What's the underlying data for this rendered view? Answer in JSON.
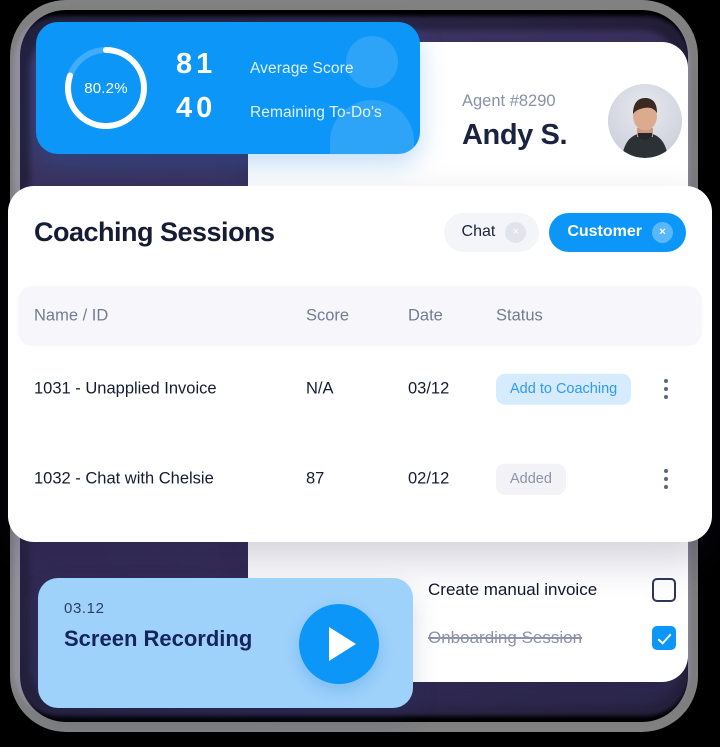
{
  "stats": {
    "donut_value": "80.2%",
    "donut_percent": 80.2,
    "rows": [
      {
        "number": "81",
        "label": "Average Score"
      },
      {
        "number": "40",
        "label": "Remaining To-Do's"
      }
    ]
  },
  "agent": {
    "id_label": "Agent #8290",
    "name": "Andy S."
  },
  "coaching": {
    "title": "Coaching Sessions",
    "chips": [
      {
        "label": "Chat",
        "style": "ghost",
        "close": "×"
      },
      {
        "label": "Customer",
        "style": "solid",
        "close": "×"
      }
    ],
    "columns": [
      "Name / ID",
      "Score",
      "Date",
      "Status"
    ],
    "rows": [
      {
        "name": "1031 - Unapplied Invoice",
        "score": "N/A",
        "date": "03/12",
        "status": "Add to Coaching",
        "status_style": "blue"
      },
      {
        "name": "1032 - Chat with Chelsie",
        "score": "87",
        "date": "02/12",
        "status": "Added",
        "status_style": "grey"
      }
    ]
  },
  "options": {
    "items": [
      {
        "label": "Create manual invoice",
        "checked": false
      },
      {
        "label": "Onboarding Session",
        "checked": true
      }
    ]
  },
  "recording": {
    "date": "03.12",
    "title": "Screen Recording"
  },
  "colors": {
    "accent_blue": "#0c96f7",
    "light_blue": "#9fd2fb",
    "badge_blue_bg": "#d6ebfd",
    "badge_grey_bg": "#f2f2f7",
    "dark_text": "#151c33"
  }
}
